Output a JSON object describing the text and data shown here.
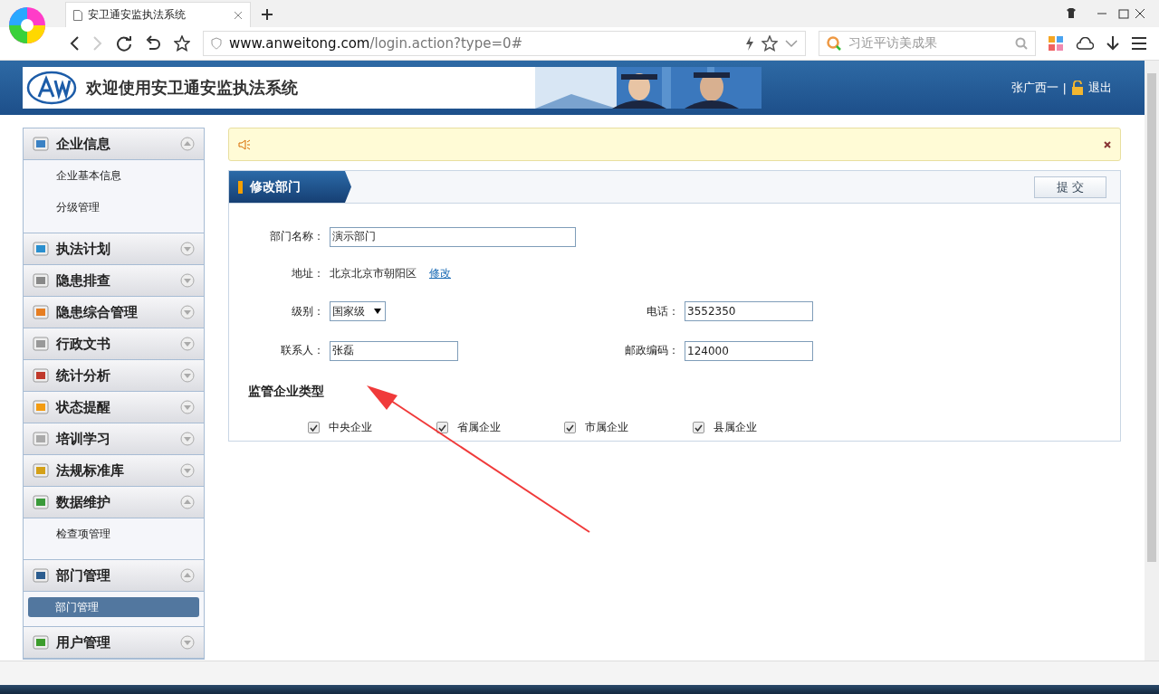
{
  "browser": {
    "tab_title": "安卫通安监执法系统",
    "url_host": "www.anweitong.com",
    "url_path": "/login.action?type=0#",
    "search_placeholder": "习近平访美成果"
  },
  "header": {
    "title": "欢迎使用安卫通安监执法系统",
    "user": "张广西一",
    "separator": "|",
    "logout": "退出"
  },
  "sidebar": {
    "sections": [
      {
        "label": "企业信息",
        "expanded": true,
        "items": [
          {
            "label": "企业基本信息",
            "selected": false
          },
          {
            "label": "分级管理",
            "selected": false
          }
        ]
      },
      {
        "label": "执法计划",
        "expanded": false
      },
      {
        "label": "隐患排查",
        "expanded": false
      },
      {
        "label": "隐患综合管理",
        "expanded": false
      },
      {
        "label": "行政文书",
        "expanded": false
      },
      {
        "label": "统计分析",
        "expanded": false
      },
      {
        "label": "状态提醒",
        "expanded": false
      },
      {
        "label": "培训学习",
        "expanded": false
      },
      {
        "label": "法规标准库",
        "expanded": false
      },
      {
        "label": "数据维护",
        "expanded": true,
        "items": [
          {
            "label": "检查项管理",
            "selected": false
          }
        ]
      },
      {
        "label": "部门管理",
        "expanded": true,
        "items": [
          {
            "label": "部门管理",
            "selected": true
          }
        ]
      },
      {
        "label": "用户管理",
        "expanded": false
      }
    ]
  },
  "panel": {
    "title": "修改部门",
    "submit": "提 交",
    "name": {
      "label": "部门名称：",
      "value": "演示部门"
    },
    "address": {
      "label": "地址：",
      "value": "北京北京市朝阳区",
      "link": "修改"
    },
    "level": {
      "label": "级别：",
      "value": "国家级"
    },
    "phone": {
      "label": "电话：",
      "value": "3552350"
    },
    "contact": {
      "label": "联系人：",
      "value": "张磊"
    },
    "postcode": {
      "label": "邮政编码：",
      "value": "124000"
    },
    "types_title": "监管企业类型",
    "types": [
      {
        "label": "中央企业",
        "checked": true
      },
      {
        "label": "省属企业",
        "checked": true
      },
      {
        "label": "市属企业",
        "checked": true
      },
      {
        "label": "县属企业",
        "checked": true
      }
    ]
  }
}
